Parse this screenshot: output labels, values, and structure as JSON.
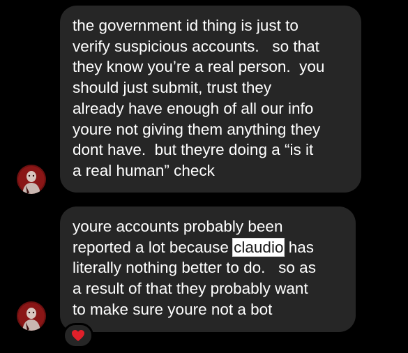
{
  "messages": [
    {
      "lines": [
        "the government id thing is just to",
        "verify suspicious accounts.   so that",
        "they know you’re a real person.  you",
        "should just submit, trust they",
        "already have enough of all our info",
        "youre not giving them anything they",
        "dont have.  but theyre doing a “is it",
        "a real human” check"
      ]
    },
    {
      "line1": "youre accounts probably been",
      "line2_before": "reported a lot because ",
      "line2_highlight": "claudio",
      "line2_after": " has",
      "line3": "literally nothing better to do.   so as",
      "line4": "a result of that they probably want",
      "line5": "to make sure youre not a bot"
    }
  ],
  "reaction": {
    "emoji": "heart-icon",
    "color": "#e0202a"
  },
  "colors": {
    "background": "#000000",
    "bubble": "#262626",
    "text": "#ffffff"
  }
}
